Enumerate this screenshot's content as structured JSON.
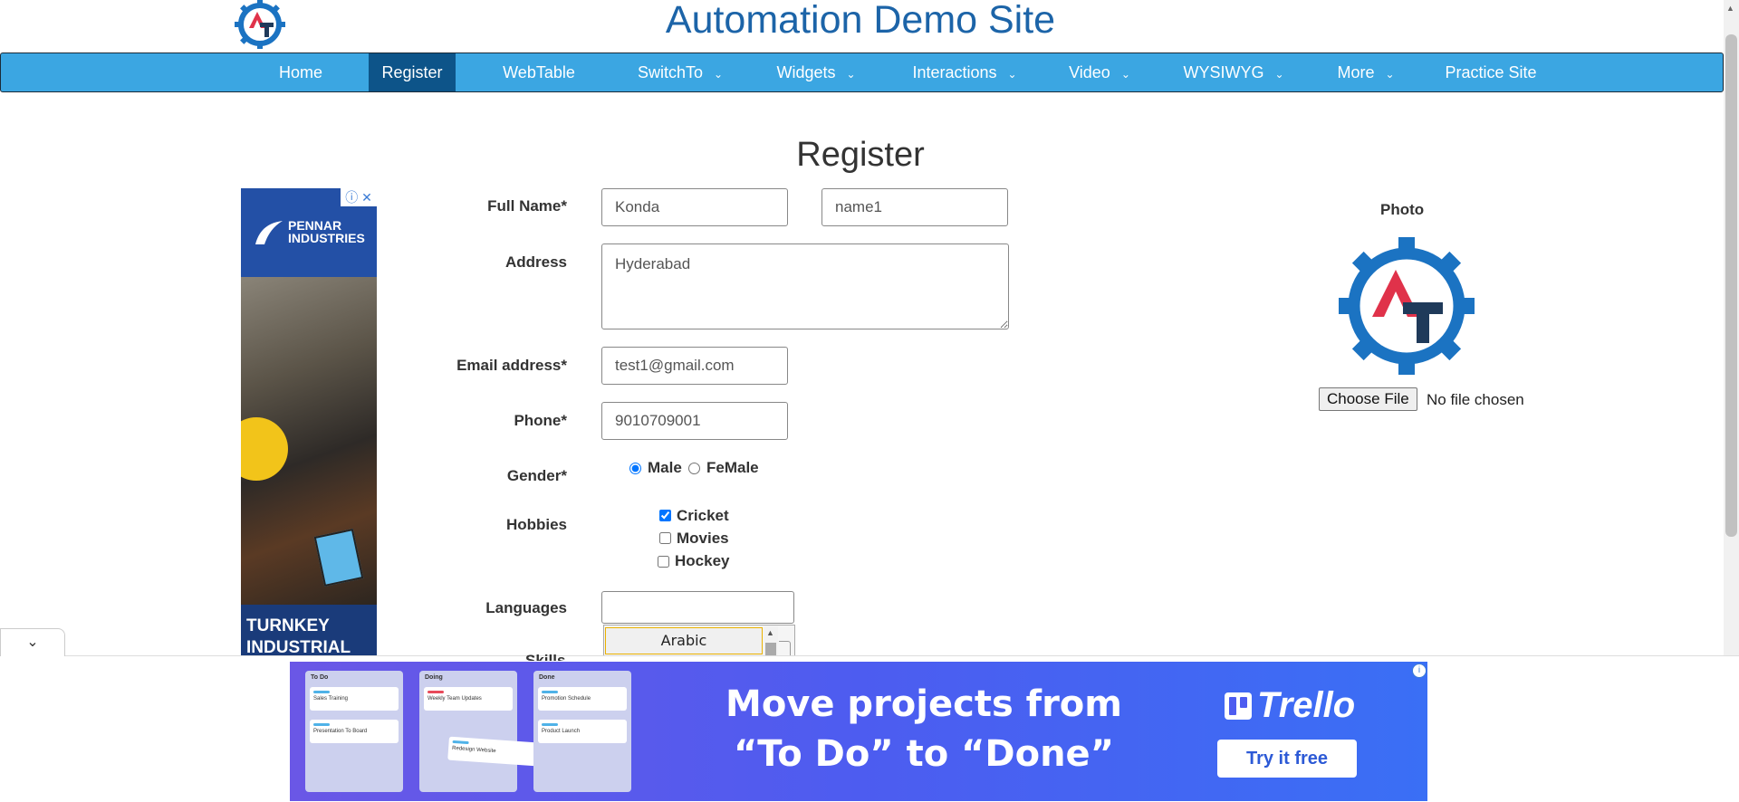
{
  "site": {
    "title": "Automation Demo Site"
  },
  "nav": {
    "items": [
      {
        "label": "Home",
        "dropdown": false,
        "active": false
      },
      {
        "label": "Register",
        "dropdown": false,
        "active": true
      },
      {
        "label": "WebTable",
        "dropdown": false,
        "active": false
      },
      {
        "label": "SwitchTo",
        "dropdown": true,
        "active": false
      },
      {
        "label": "Widgets",
        "dropdown": true,
        "active": false
      },
      {
        "label": "Interactions",
        "dropdown": true,
        "active": false
      },
      {
        "label": "Video",
        "dropdown": true,
        "active": false
      },
      {
        "label": "WYSIWYG",
        "dropdown": true,
        "active": false
      },
      {
        "label": "More",
        "dropdown": true,
        "active": false
      },
      {
        "label": "Practice Site",
        "dropdown": false,
        "active": false
      }
    ]
  },
  "ad_left": {
    "brand_line1": "PENNAR",
    "brand_line2": "INDUSTRIES",
    "tagline_line1": "TURNKEY",
    "tagline_line2": "INDUSTRIAL",
    "info_icon": "ⓘ",
    "close_icon": "✕"
  },
  "form": {
    "heading": "Register",
    "full_name_label": "Full Name*",
    "first_name_value": "Konda",
    "last_name_value": "name1",
    "address_label": "Address",
    "address_value": "Hyderabad",
    "email_label": "Email address*",
    "email_value": "test1@gmail.com",
    "phone_label": "Phone*",
    "phone_value": "9010709001",
    "gender_label": "Gender*",
    "gender_options": [
      "Male",
      "FeMale"
    ],
    "gender_selected": "Male",
    "hobbies_label": "Hobbies",
    "hobbies": [
      {
        "label": "Cricket",
        "checked": true
      },
      {
        "label": "Movies",
        "checked": false
      },
      {
        "label": "Hockey",
        "checked": false
      }
    ],
    "languages_label": "Languages",
    "languages_value": "",
    "language_option": "Arabic",
    "skills_label_partial": "Skills"
  },
  "photo": {
    "label": "Photo",
    "choose_file_label": "Choose File",
    "no_file_text": "No file chosen"
  },
  "ad_bottom": {
    "columns": [
      {
        "title": "To Do",
        "cards": [
          "Sales Training",
          "Presentation To Board"
        ]
      },
      {
        "title": "Doing",
        "cards": [
          "Weekly Team Updates",
          "Redesign Website"
        ]
      },
      {
        "title": "Done",
        "cards": [
          "Promotion Schedule",
          "Product Launch"
        ]
      }
    ],
    "headline_line1": "Move projects from",
    "headline_line2": "“To Do” to “Done”",
    "brand": "Trello",
    "cta": "Try it free",
    "info_icon": "ⓘ"
  },
  "colors": {
    "nav_bg": "#3ba6e2",
    "nav_active": "#0d5489",
    "title": "#1c64a8",
    "logo_blue": "#1b73c2",
    "logo_red": "#e0324a",
    "logo_dark": "#1f3a5a"
  }
}
